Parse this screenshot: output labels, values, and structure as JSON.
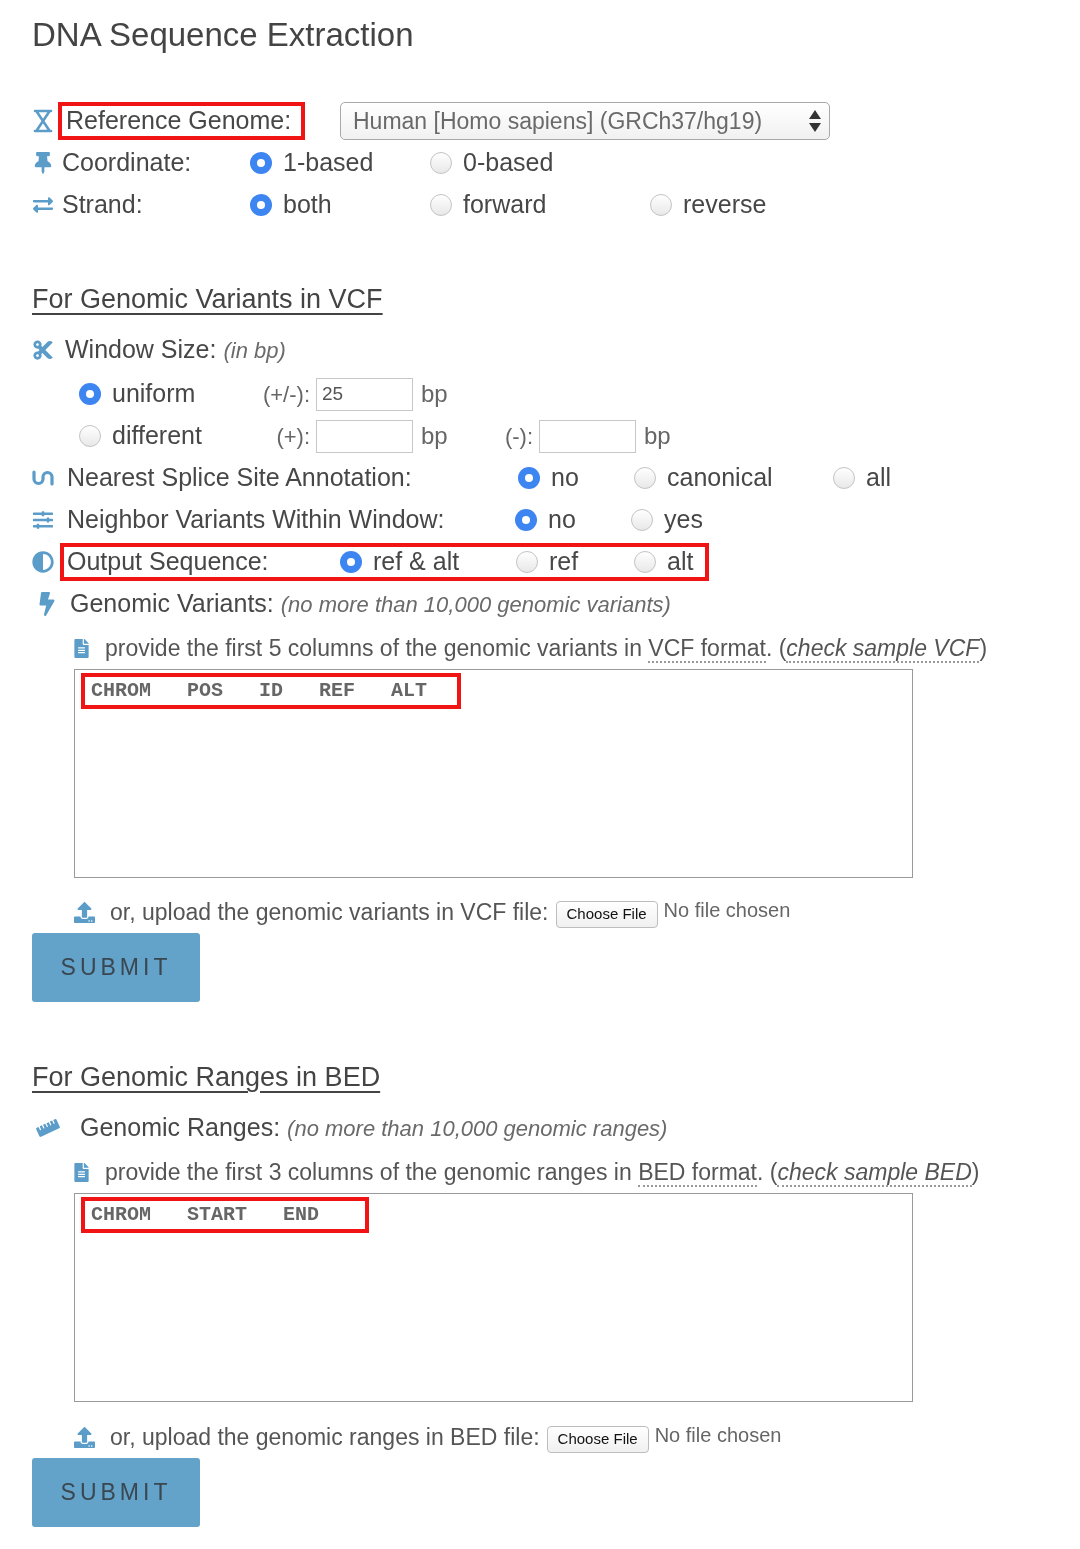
{
  "title": "DNA Sequence Extraction",
  "settings": [
    {
      "kind": "select",
      "label": "Reference Genome:",
      "highlighted": true,
      "value": "Human [Homo sapiens] (GRCh37/hg19)"
    },
    {
      "kind": "radio",
      "label": "Coordinate:",
      "highlighted": false,
      "options": [
        {
          "label": "1-based",
          "selected": true
        },
        {
          "label": "0-based",
          "selected": false
        }
      ]
    },
    {
      "kind": "radio",
      "label": "Strand:",
      "highlighted": false,
      "options": [
        {
          "label": "both",
          "selected": true
        },
        {
          "label": "forward",
          "selected": false
        },
        {
          "label": "reverse",
          "selected": false
        }
      ]
    }
  ],
  "vcf_section": {
    "heading": "For Genomic Variants in VCF",
    "window_size": {
      "label": "Window Size:",
      "hint": "(in bp)",
      "options": [
        {
          "label": "uniform",
          "selected": true,
          "fields": [
            {
              "prefix": "(+/-):",
              "value": "25",
              "unit": "bp"
            }
          ]
        },
        {
          "label": "different",
          "selected": false,
          "fields": [
            {
              "prefix": "(+):",
              "unit": "bp"
            },
            {
              "prefix": "(-):",
              "unit": "bp"
            }
          ]
        }
      ]
    },
    "option_rows": [
      {
        "label": "Nearest Splice Site Annotation:",
        "highlighted": false,
        "options": [
          {
            "label": "no",
            "selected": true
          },
          {
            "label": "canonical",
            "selected": false
          },
          {
            "label": "all",
            "selected": false
          }
        ]
      },
      {
        "label": "Neighbor Variants Within Window:",
        "highlighted": false,
        "options": [
          {
            "label": "no",
            "selected": true
          },
          {
            "label": "yes",
            "selected": false
          }
        ]
      },
      {
        "label": "Output Sequence:",
        "highlighted": true,
        "options": [
          {
            "label": "ref & alt",
            "selected": true
          },
          {
            "label": "ref",
            "selected": false
          },
          {
            "label": "alt",
            "selected": false
          }
        ]
      }
    ],
    "input": {
      "label": "Genomic Variants:",
      "hint": "(no more than 10,000 genomic variants)",
      "instruction": {
        "text": "provide the first 5 columns of the genomic variants in ",
        "link": "VCF format",
        "between": ". (",
        "sample_link": "check sample VCF",
        "after": ")"
      },
      "placeholder": "CHROM   POS   ID   REF   ALT",
      "highlighted": true,
      "upload_label": "or, upload the genomic variants in VCF file:",
      "file_button": "Choose File",
      "file_status": "No file chosen",
      "submit": "SUBMIT"
    }
  },
  "bed_section": {
    "heading": "For Genomic Ranges in BED",
    "input": {
      "label": "Genomic Ranges:",
      "hint": "(no more than 10,000 genomic ranges)",
      "instruction": {
        "text": "provide the first 3 columns of the genomic ranges in ",
        "link": "BED format",
        "between": ". (",
        "sample_link": "check sample BED",
        "after": ")"
      },
      "placeholder": "CHROM   START   END",
      "highlighted": true,
      "upload_label": "or, upload the genomic ranges in BED file:",
      "file_button": "Choose File",
      "file_status": "No file chosen",
      "submit": "SUBMIT"
    }
  }
}
